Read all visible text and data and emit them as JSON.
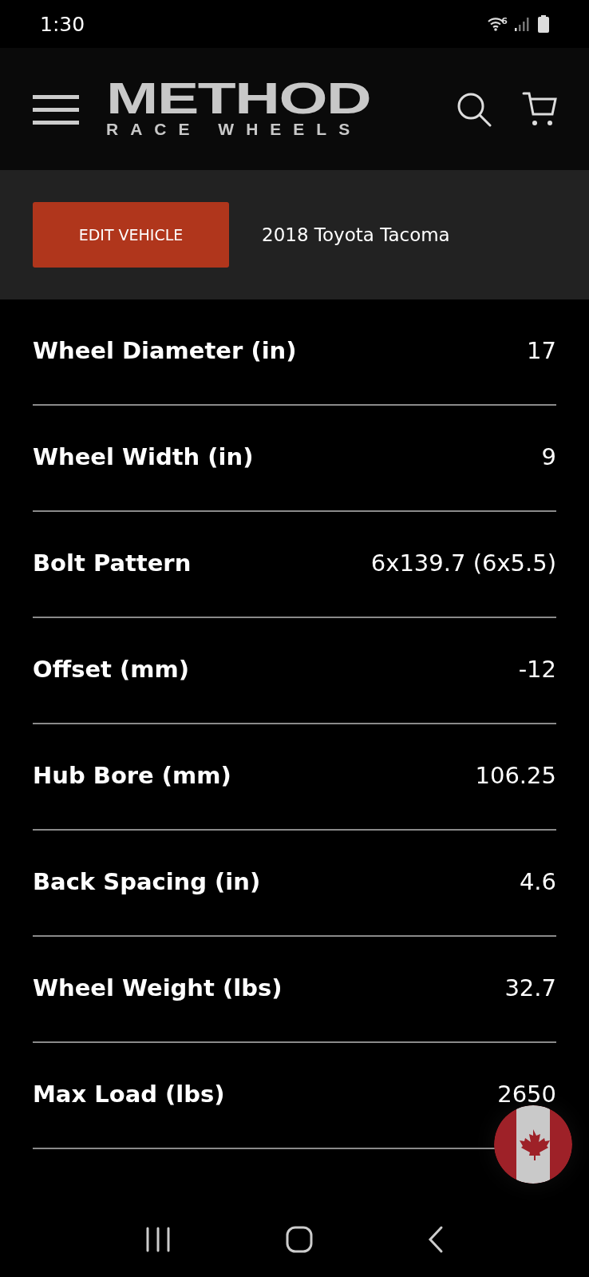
{
  "status_bar": {
    "time": "1:30",
    "wifi_badge": "6"
  },
  "header": {
    "logo": {
      "title": "METHOD",
      "subtitle": "RACE WHEELS"
    }
  },
  "vehicle_bar": {
    "button": "EDIT VEHICLE",
    "vehicle": "2018 Toyota Tacoma"
  },
  "specs": [
    {
      "label": "Wheel Diameter (in)",
      "value": "17"
    },
    {
      "label": "Wheel Width (in)",
      "value": "9"
    },
    {
      "label": "Bolt Pattern",
      "value": "6x139.7 (6x5.5)"
    },
    {
      "label": "Offset (mm)",
      "value": "-12"
    },
    {
      "label": "Hub Bore (mm)",
      "value": "106.25"
    },
    {
      "label": "Back Spacing (in)",
      "value": "4.6"
    },
    {
      "label": "Wheel Weight (lbs)",
      "value": "32.7"
    },
    {
      "label": "Max Load (lbs)",
      "value": "2650"
    }
  ]
}
